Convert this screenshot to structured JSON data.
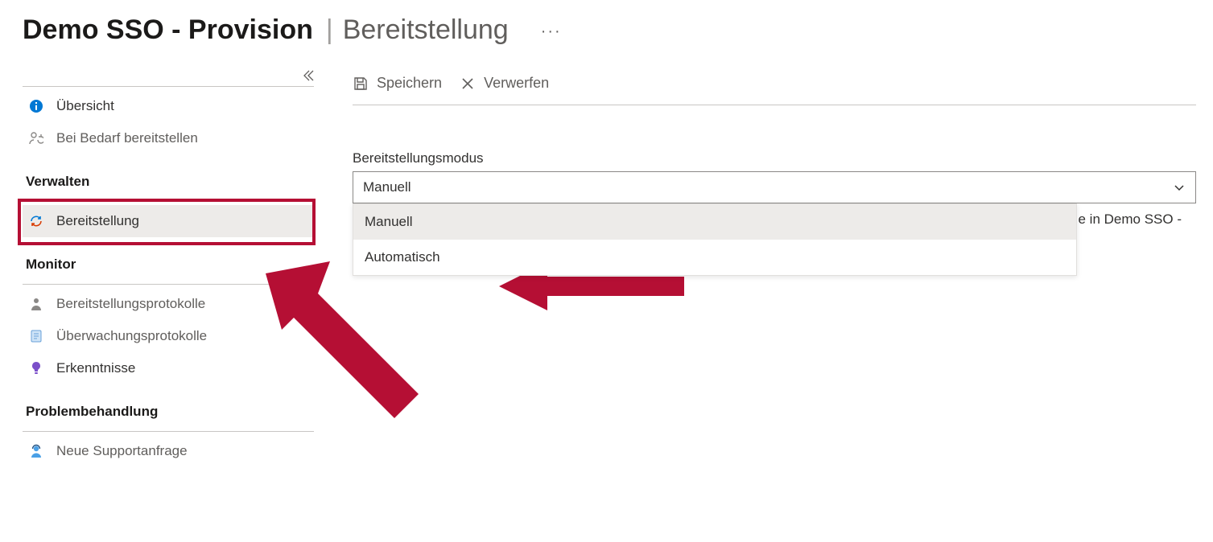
{
  "title": {
    "app_name": "Demo SSO - Provision",
    "divider": "|",
    "page_name": "Bereitstellung",
    "more_glyph": "···"
  },
  "sidebar": {
    "top_items": [
      {
        "label": "Übersicht"
      },
      {
        "label": "Bei Bedarf bereitstellen"
      }
    ],
    "sections": [
      {
        "header": "Verwalten",
        "items": [
          {
            "label": "Bereitstellung",
            "selected": true
          }
        ]
      },
      {
        "header": "Monitor",
        "items": [
          {
            "label": "Bereitstellungsprotokolle"
          },
          {
            "label": "Überwachungsprotokolle"
          },
          {
            "label": "Erkenntnisse"
          }
        ]
      },
      {
        "header": "Problembehandlung",
        "items": [
          {
            "label": "Neue Supportanfrage"
          }
        ]
      }
    ]
  },
  "toolbar": {
    "save_label": "Speichern",
    "discard_label": "Verwerfen"
  },
  "form": {
    "mode_label": "Bereitstellungsmodus",
    "mode_selected": "Manuell",
    "mode_options": [
      "Manuell",
      "Automatisch"
    ]
  },
  "background_text_fragment": "e in Demo SSO -",
  "annotation": {
    "highlight_color": "#b50f34"
  }
}
